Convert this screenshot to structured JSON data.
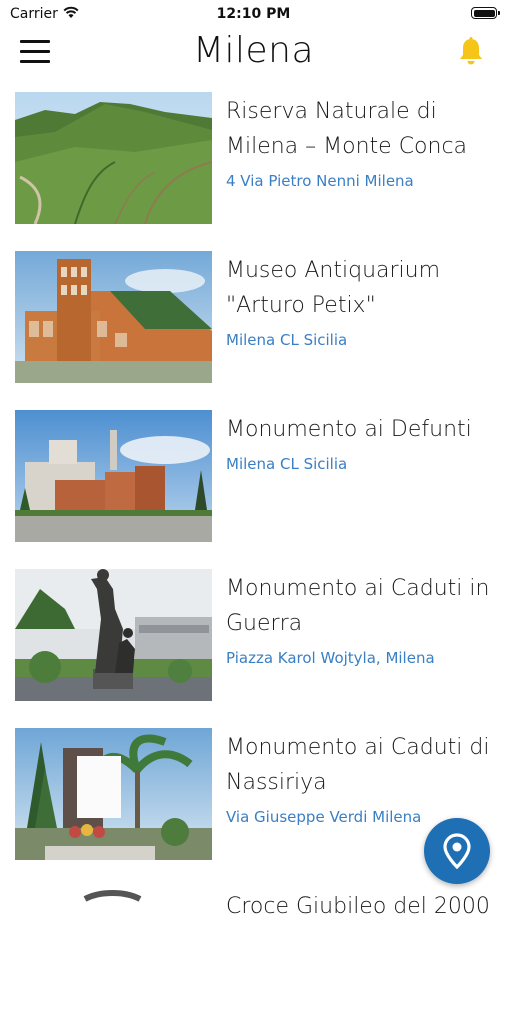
{
  "status_bar": {
    "carrier": "Carrier",
    "time": "12:10 PM"
  },
  "header": {
    "title": "Milena"
  },
  "places": [
    {
      "title": "Riserva Naturale di Milena – Monte Conca",
      "address": "4 Via Pietro Nenni Milena"
    },
    {
      "title": "Museo Antiquarium \"Arturo Petix\"",
      "address": "Milena CL Sicilia"
    },
    {
      "title": "Monumento ai Defunti",
      "address": "Milena CL Sicilia"
    },
    {
      "title": "Monumento ai Caduti in Guerra",
      "address": "Piazza Karol Wojtyla, Milena"
    },
    {
      "title": "Monumento ai Caduti di Nassiriya",
      "address": "Via Giuseppe Verdi Milena"
    },
    {
      "title": "Croce Giubileo del 2000",
      "address": ""
    }
  ],
  "colors": {
    "accent": "#3a7fc4",
    "fab": "#1f6fb5",
    "bell": "#f5c518"
  },
  "icons": {
    "menu": "hamburger-menu-icon",
    "notifications": "bell-icon",
    "map": "map-pin-icon"
  }
}
